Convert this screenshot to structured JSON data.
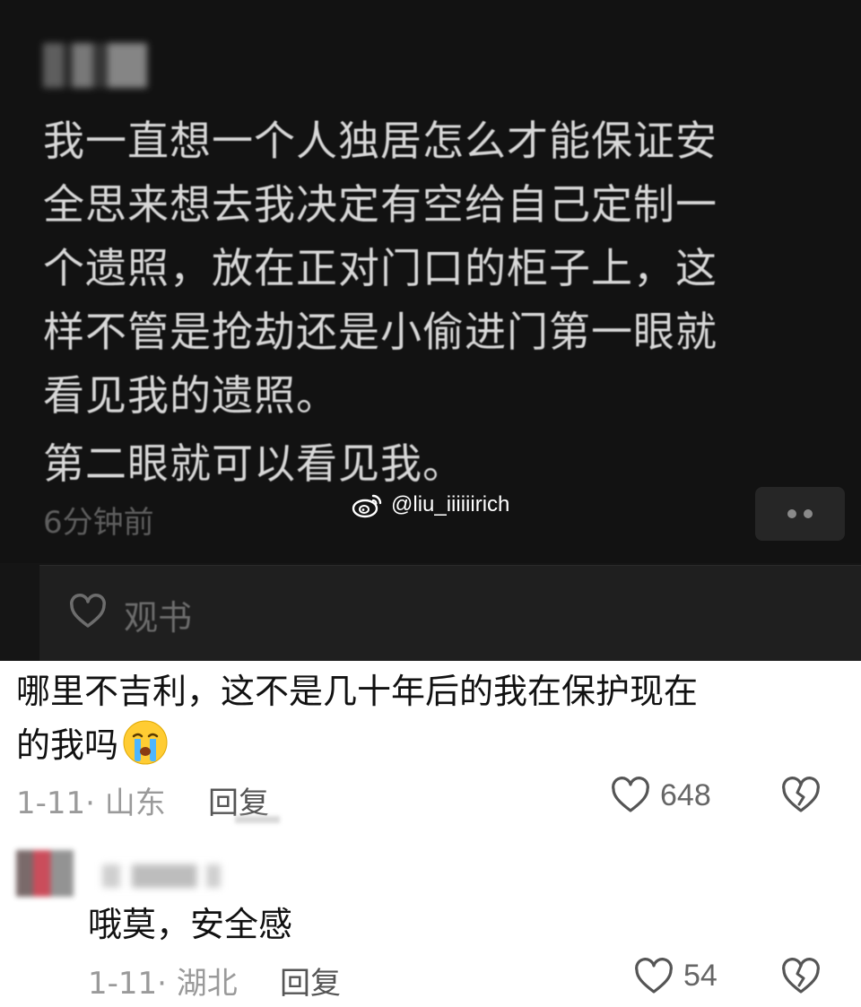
{
  "post": {
    "text_lines": [
      "我一直想一个人独居怎么才能保证安",
      "全思来想去我决定有空给自己定制一",
      "个遗照，放在正对门口的柜子上，这",
      "样不管是抢劫还是小偷进门第一眼就",
      "看见我的遗照。"
    ],
    "text_second": "第二眼就可以看见我。",
    "time": "6分钟前",
    "action_label": "观书"
  },
  "watermark": {
    "handle": "@liu_iiiiiirich"
  },
  "comments": [
    {
      "text_line1": "哪里不吉利，这不是几十年后的我在保护现在",
      "text_line2": "的我吗",
      "emoji": "crying-face",
      "meta": "1-11· 山东",
      "reply_label": "回复",
      "likes": "648"
    },
    {
      "text": "哦莫，安全感",
      "meta": "1-11· 湖北",
      "reply_label": "回复",
      "likes": "54"
    }
  ],
  "colors": {
    "dark_bg": "#121212",
    "post_text": "#d8d8d8",
    "comment_text": "#111111",
    "meta_text": "#9a9a9a"
  },
  "icons": [
    "weibo-logo-icon",
    "heart-outline-icon",
    "broken-heart-icon",
    "more-dots-icon",
    "crying-face-emoji"
  ]
}
